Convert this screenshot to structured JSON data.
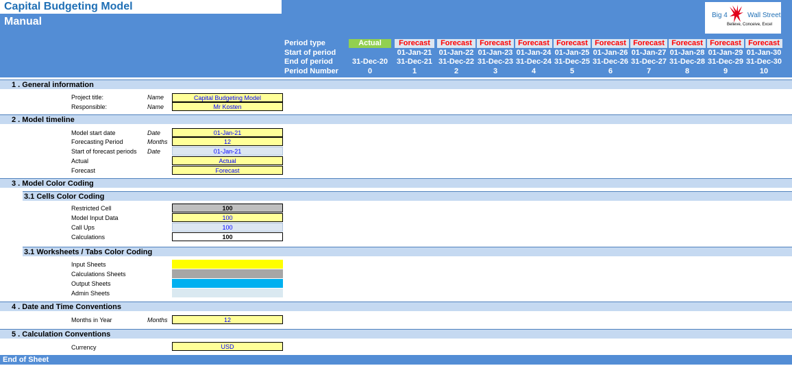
{
  "header": {
    "model_title": "Capital Budgeting Model",
    "page_title": "Manual",
    "logo": {
      "left_text": "Big 4",
      "right_text": "Wall Street",
      "tagline": "Believe, Conceive, Excel"
    }
  },
  "timeline": {
    "row_labels": {
      "period_type": "Period type",
      "start": "Start of period",
      "end": "End of period",
      "number": "Period Number"
    },
    "columns": [
      {
        "type": "Actual",
        "start": "",
        "end": "31-Dec-20",
        "num": "0"
      },
      {
        "type": "Forecast",
        "start": "01-Jan-21",
        "end": "31-Dec-21",
        "num": "1"
      },
      {
        "type": "Forecast",
        "start": "01-Jan-22",
        "end": "31-Dec-22",
        "num": "2"
      },
      {
        "type": "Forecast",
        "start": "01-Jan-23",
        "end": "31-Dec-23",
        "num": "3"
      },
      {
        "type": "Forecast",
        "start": "01-Jan-24",
        "end": "31-Dec-24",
        "num": "4"
      },
      {
        "type": "Forecast",
        "start": "01-Jan-25",
        "end": "31-Dec-25",
        "num": "5"
      },
      {
        "type": "Forecast",
        "start": "01-Jan-26",
        "end": "31-Dec-26",
        "num": "6"
      },
      {
        "type": "Forecast",
        "start": "01-Jan-27",
        "end": "31-Dec-27",
        "num": "7"
      },
      {
        "type": "Forecast",
        "start": "01-Jan-28",
        "end": "31-Dec-28",
        "num": "8"
      },
      {
        "type": "Forecast",
        "start": "01-Jan-29",
        "end": "31-Dec-29",
        "num": "9"
      },
      {
        "type": "Forecast",
        "start": "01-Jan-30",
        "end": "31-Dec-30",
        "num": "10"
      }
    ]
  },
  "general": {
    "heading": "1 . General information",
    "project_title": {
      "label": "Project title:",
      "unit": "Name",
      "value": "Capital Budgeting Model"
    },
    "responsible": {
      "label": "Responsible:",
      "unit": "Name",
      "value": "Mr Kosten"
    }
  },
  "timeline_section": {
    "heading": "2 . Model timeline",
    "start_date": {
      "label": "Model start date",
      "unit": "Date",
      "value": "01-Jan-21"
    },
    "forecast_period": {
      "label": "Forecasting Period",
      "unit": "Months",
      "value": "12"
    },
    "start_forecast": {
      "label": "Start of forecast periods",
      "unit": "Date",
      "value": "01-Jan-21"
    },
    "actual": {
      "label": "Actual",
      "value": "Actual"
    },
    "forecast": {
      "label": "Forecast",
      "value": "Forecast"
    }
  },
  "color_coding": {
    "heading": "3 . Model Color Coding",
    "cells_heading": "3.1 Cells Color Coding",
    "restricted": {
      "label": "Restricted Cell",
      "value": "100"
    },
    "input": {
      "label": "Model Input Data",
      "value": "100"
    },
    "callups": {
      "label": "Call Ups",
      "value": "100"
    },
    "calculations": {
      "label": "Calculations",
      "value": "100"
    },
    "tabs_heading": "3.1 Worksheets / Tabs Color Coding",
    "input_sheets": {
      "label": "Input Sheets",
      "color": "#ffff00"
    },
    "calc_sheets": {
      "label": "Calculations Sheets",
      "color": "#a6a6a6"
    },
    "output_sheets": {
      "label": "Output Sheets",
      "color": "#00b0f0"
    },
    "admin_sheets": {
      "label": "Admin Sheets",
      "color": "#dae9f1"
    }
  },
  "date_time": {
    "heading": "4 . Date and Time Conventions",
    "months": {
      "label": "Months in Year",
      "unit": "Months",
      "value": "12"
    }
  },
  "calc_conv": {
    "heading": "5 . Calculation Conventions",
    "currency": {
      "label": "Currency",
      "value": "USD"
    }
  },
  "footer": {
    "end_label": "End of Sheet"
  },
  "colors": {
    "header_blue": "#538dd5",
    "section_blue": "#c5d9f1",
    "input_yellow": "#ffff99",
    "forecast_red": "#ff0000",
    "actual_green": "#92d050"
  }
}
